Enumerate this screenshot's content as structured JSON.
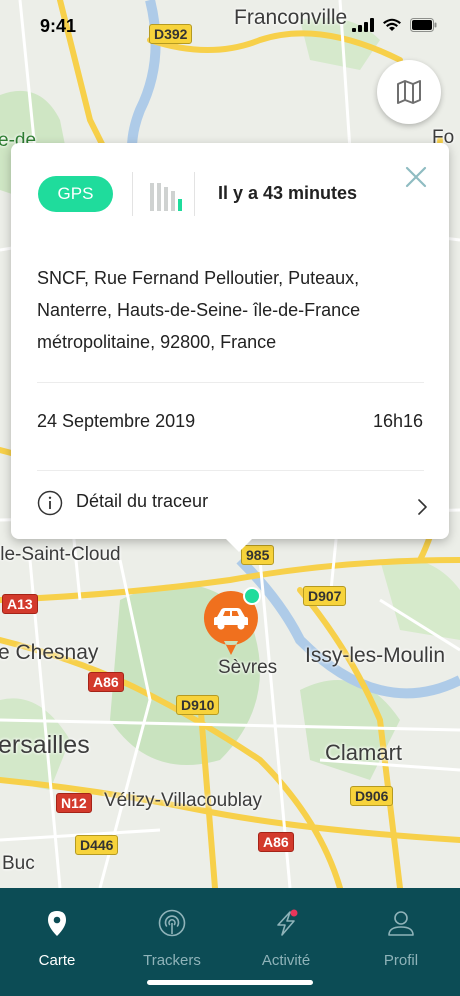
{
  "status_bar": {
    "time": "9:41"
  },
  "map": {
    "labels": {
      "franconville": "Franconville",
      "de": "e-de",
      "fo": "Fo",
      "saint_cloud": "lle-Saint-Cloud",
      "chesnay": "e Chesnay",
      "sevres": "Sèvres",
      "issy": "Issy-les-Moulin",
      "versailles": "ersailles",
      "clamart": "Clamart",
      "velizy": "Vélizy-Villacoublay",
      "buc": "Buc"
    },
    "road_badges": {
      "d392": "D392",
      "a13": "A13",
      "n985": "985",
      "d907": "D907",
      "a86_left": "A86",
      "d910": "D910",
      "n12": "N12",
      "d906": "D906",
      "d446": "D446",
      "a86_bottom": "A86"
    }
  },
  "card": {
    "gps_label": "GPS",
    "time_ago": "Il y a 43 minutes",
    "address_lines": [
      "SNCF, Rue Fernand Pelloutier, Puteaux,",
      "Nanterre, Hauts-de-Seine- île-de-France",
      "métropolitaine, 92800, France"
    ],
    "date": "24 Septembre 2019",
    "hour": "16h16",
    "detail_label": "Détail du traceur",
    "signal_level": 1,
    "signal_bars": 5
  },
  "tabbar": {
    "tabs": [
      {
        "label": "Carte",
        "icon": "map-pin-icon",
        "active": true
      },
      {
        "label": "Trackers",
        "icon": "signal-broadcast-icon",
        "active": false
      },
      {
        "label": "Activité",
        "icon": "lightning-icon",
        "active": false
      },
      {
        "label": "Profil",
        "icon": "user-icon",
        "active": false
      }
    ]
  },
  "colors": {
    "accent_green": "#1fdc9c",
    "marker_orange": "#f0701e",
    "tabbar_bg": "#0c4c55",
    "notification_red": "#e8365a"
  }
}
